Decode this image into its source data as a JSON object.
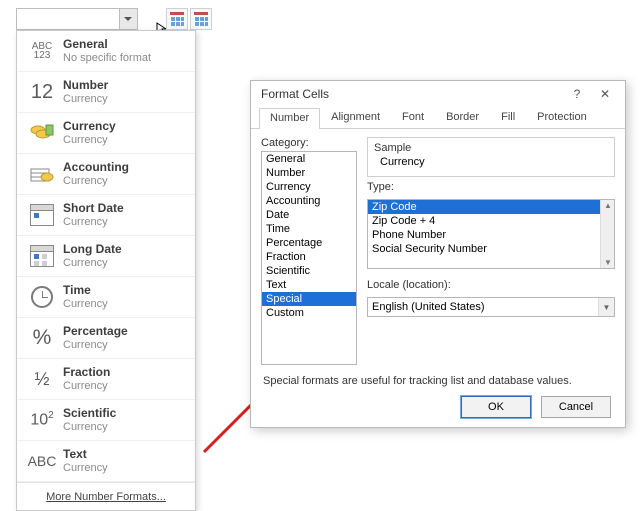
{
  "ribbon": {
    "combo_value": ""
  },
  "dropdown": {
    "items": [
      {
        "title": "General",
        "sub": "No specific format",
        "icon": "general"
      },
      {
        "title": "Number",
        "sub": "Currency",
        "icon": "number"
      },
      {
        "title": "Currency",
        "sub": "Currency",
        "icon": "currency"
      },
      {
        "title": "Accounting",
        "sub": " Currency",
        "icon": "accounting"
      },
      {
        "title": "Short Date",
        "sub": "Currency",
        "icon": "shortdate"
      },
      {
        "title": "Long Date",
        "sub": "Currency",
        "icon": "longdate"
      },
      {
        "title": "Time",
        "sub": "Currency",
        "icon": "time"
      },
      {
        "title": "Percentage",
        "sub": "Currency",
        "icon": "percent"
      },
      {
        "title": "Fraction",
        "sub": "Currency",
        "icon": "fraction"
      },
      {
        "title": "Scientific",
        "sub": "Currency",
        "icon": "scientific"
      },
      {
        "title": "Text",
        "sub": "Currency",
        "icon": "text"
      }
    ],
    "more": "More Number Formats..."
  },
  "dialog": {
    "title": "Format Cells",
    "tabs": [
      "Number",
      "Alignment",
      "Font",
      "Border",
      "Fill",
      "Protection"
    ],
    "active_tab": 0,
    "category_label": "Category:",
    "categories": [
      "General",
      "Number",
      "Currency",
      "Accounting",
      "Date",
      "Time",
      "Percentage",
      "Fraction",
      "Scientific",
      "Text",
      "Special",
      "Custom"
    ],
    "category_selected": "Special",
    "sample_label": "Sample",
    "sample_value": "Currency",
    "type_label": "Type:",
    "types": [
      "Zip Code",
      "Zip Code + 4",
      "Phone Number",
      "Social Security Number"
    ],
    "type_selected": "Zip Code",
    "locale_label": "Locale (location):",
    "locale_value": "English (United States)",
    "description": "Special formats are useful for tracking list and database values.",
    "ok": "OK",
    "cancel": "Cancel"
  }
}
